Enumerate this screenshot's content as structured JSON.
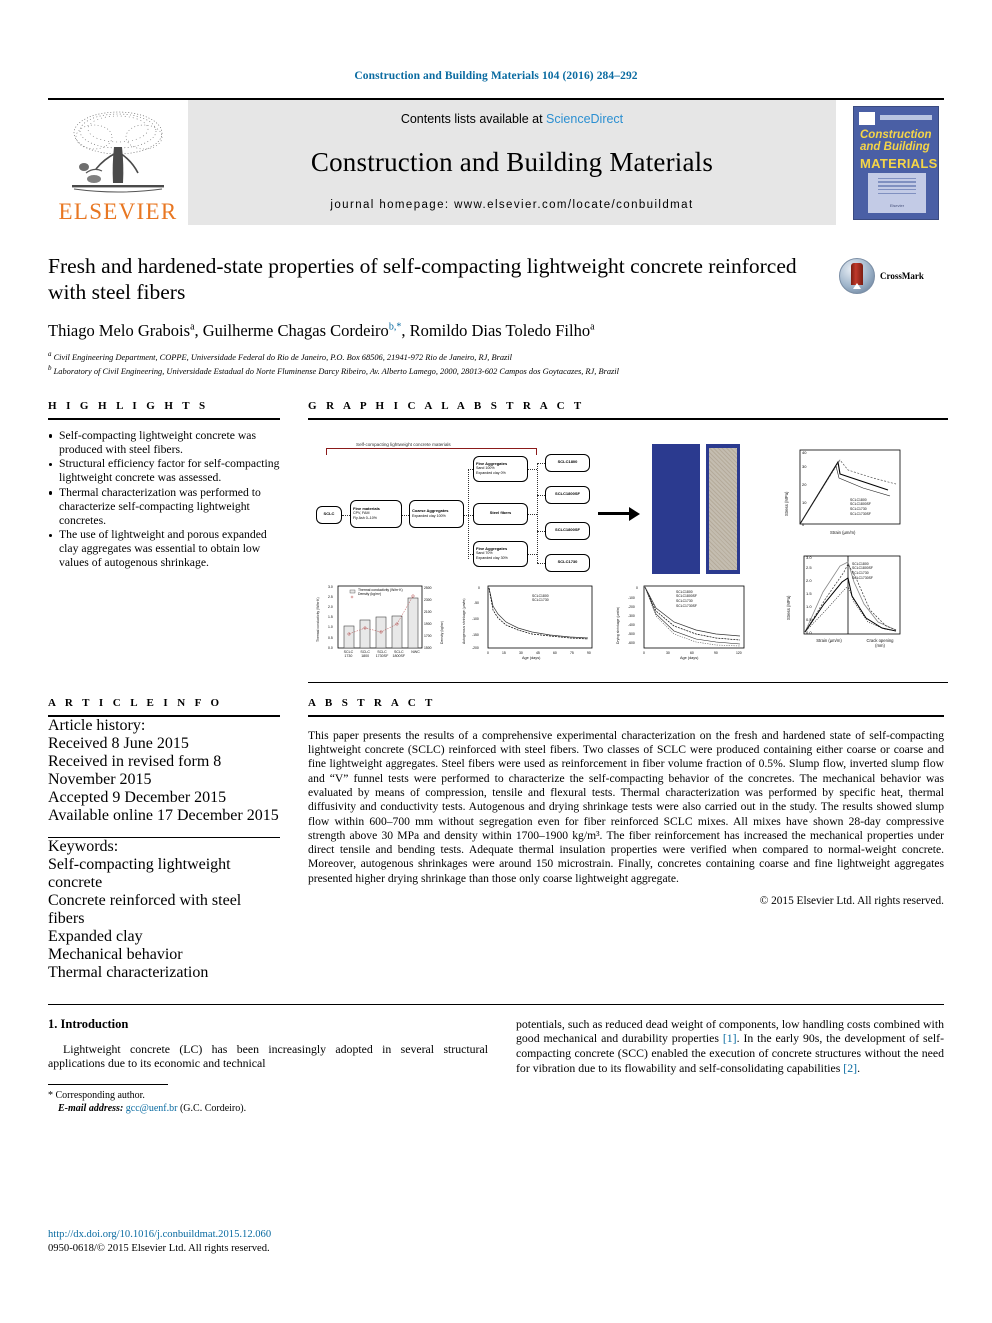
{
  "running_head": "Construction and Building Materials 104 (2016) 284–292",
  "masthead": {
    "contents_prefix": "Contents lists available at ",
    "sciencedirect": "ScienceDirect",
    "journal_name": "Construction and Building Materials",
    "homepage": "journal homepage: www.elsevier.com/locate/conbuildmat",
    "publisher": "ELSEVIER",
    "cover": {
      "line1": "Construction",
      "line2": "and Building",
      "line3": "MATERIALS",
      "blurb": "An international journal dedicated to the investigation and innovative use of materials in construction and repair",
      "foot": "Elsevier"
    }
  },
  "article": {
    "title": "Fresh and hardened-state properties of self-compacting lightweight concrete reinforced with steel fibers",
    "authors": [
      {
        "name": "Thiago Melo Grabois",
        "sup": "a"
      },
      {
        "name": "Guilherme Chagas Cordeiro",
        "sup": "b,*"
      },
      {
        "name": "Romildo Dias Toledo Filho",
        "sup": "a"
      }
    ],
    "affiliations": [
      {
        "mark": "a",
        "text": "Civil Engineering Department, COPPE, Universidade Federal do Rio de Janeiro, P.O. Box 68506, 21941-972 Rio de Janeiro, RJ, Brazil"
      },
      {
        "mark": "b",
        "text": "Laboratory of Civil Engineering, Universidade Estadual do Norte Fluminense Darcy Ribeiro, Av. Alberto Lamego, 2000, 28013-602 Campos dos Goytacazes, RJ, Brazil"
      }
    ],
    "crossmark_label": "CrossMark"
  },
  "highlights": {
    "heading": "H I G H L I G H T S",
    "items": [
      "Self-compacting lightweight concrete was produced with steel fibers.",
      "Structural efficiency factor for self-compacting lightweight concrete was assessed.",
      "Thermal characterization was performed to characterize self-compacting lightweight concretes.",
      "The use of lightweight and porous expanded clay aggregates was essential to obtain low values of autogenous shrinkage."
    ]
  },
  "graphical_abstract": {
    "heading": "G R A P H I C A L   A B S T R A C T",
    "flow_title": "Self-compacting lightweight concrete materials",
    "nodes": {
      "root": "SCLC",
      "fine_materials": {
        "title": "Fine materials",
        "l1": "CPV, FAM",
        "l2": "Fly Ash 0–10%"
      },
      "coarse_agg": {
        "title": "Coarse Aggregates",
        "l1": "Expanded clay 100%"
      },
      "fine_agg_top": {
        "title": "Fine Aggregates",
        "l1": "Sand 100%",
        "l2": "Expanded clay 0%"
      },
      "steel_fibers": {
        "title": "Steel fibers"
      },
      "fine_agg_bot": {
        "title": "Fine Aggregates",
        "l1": "Sand 70%",
        "l2": "Expanded clay 30%"
      }
    },
    "mixes": [
      "SCLC1800",
      "SCLC1800SF",
      "SCLC1800SF",
      "SCLC1730"
    ]
  },
  "chart_data": [
    {
      "type": "bar",
      "id": "thermal-conductivity-density",
      "title": "",
      "xlabel": "",
      "ylabel": "Thermal conductivity (W/m·K)",
      "y2label": "Density (kg/m³)",
      "categories": [
        "SCLC 1730",
        "SCLC 1800",
        "SCLC 1730SF",
        "SCLC 1800SF",
        "NWC"
      ],
      "series": [
        {
          "name": "Thermal conductivity (W/m·K)",
          "values": [
            1.05,
            1.29,
            1.46,
            1.5,
            2.63
          ],
          "kind": "bar"
        },
        {
          "name": "Density (kg/m³)",
          "values": [
            1740,
            1790,
            1730,
            1850,
            2320
          ],
          "kind": "scatter"
        }
      ],
      "ylim": [
        0.0,
        3.0
      ],
      "y2lim": [
        1500,
        2500
      ],
      "yticks": [
        0.0,
        0.5,
        1.0,
        1.5,
        2.0,
        2.5,
        3.0
      ],
      "y2ticks": [
        1500,
        1700,
        1900,
        2100,
        2300,
        2500
      ]
    },
    {
      "type": "line",
      "id": "autogenous-shrinkage",
      "title": "",
      "xlabel": "Age (days)",
      "ylabel": "Autogenous shrinkage (µm/m)",
      "xlim": [
        0,
        90
      ],
      "ylim": [
        -200,
        0
      ],
      "xticks": [
        0,
        15,
        30,
        45,
        60,
        75,
        90
      ],
      "yticks": [
        -200,
        -150,
        -100,
        -50,
        0
      ],
      "series": [
        {
          "name": "SCLC1800",
          "x": [
            0,
            1,
            3,
            7,
            14,
            28,
            56,
            80
          ],
          "y": [
            0,
            -45,
            -70,
            -95,
            -120,
            -145,
            -160,
            -168
          ]
        },
        {
          "name": "SCLC1730",
          "x": [
            0,
            1,
            3,
            7,
            14,
            28,
            56,
            80
          ],
          "y": [
            0,
            -52,
            -78,
            -105,
            -128,
            -150,
            -163,
            -170
          ]
        }
      ]
    },
    {
      "type": "line",
      "id": "drying-shrinkage",
      "title": "",
      "xlabel": "Age (days)",
      "ylabel": "Drying shrinkage (µm/m)",
      "xlim": [
        0,
        120
      ],
      "ylim": [
        -700,
        0
      ],
      "xticks": [
        0,
        30,
        60,
        90,
        120
      ],
      "yticks": [
        -700,
        -600,
        -500,
        -400,
        -300,
        -200,
        -100,
        0
      ],
      "series": [
        {
          "name": "SCLC1800",
          "x": [
            0,
            7,
            28,
            60,
            90,
            120
          ],
          "y": [
            0,
            -240,
            -390,
            -470,
            -510,
            -530
          ]
        },
        {
          "name": "SCLC1800SF",
          "x": [
            0,
            7,
            28,
            60,
            90,
            120
          ],
          "y": [
            0,
            -270,
            -420,
            -500,
            -545,
            -565
          ]
        },
        {
          "name": "SCLC1730",
          "x": [
            0,
            7,
            28,
            60,
            90,
            120
          ],
          "y": [
            0,
            -300,
            -470,
            -560,
            -600,
            -620
          ]
        },
        {
          "name": "SCLC1730SF",
          "x": [
            0,
            7,
            28,
            60,
            90,
            120
          ],
          "y": [
            0,
            -320,
            -500,
            -590,
            -630,
            -650
          ]
        }
      ]
    },
    {
      "type": "line",
      "id": "compressive-stress-strain",
      "title": "",
      "xlabel": "Strain (µm/m)",
      "ylabel": "Stress (MPa)",
      "xlim": [
        0,
        6000
      ],
      "ylim": [
        0,
        40
      ],
      "xticks": [
        0,
        2000,
        4000,
        6000
      ],
      "yticks": [
        0,
        10,
        20,
        30,
        40
      ],
      "legend": [
        "SCLC1800",
        "SCLC1800SF",
        "SCLC1730",
        "SCLC1730SF"
      ],
      "series": [
        {
          "name": "SCLC1800",
          "peak_x": 2300,
          "peak_y": 33
        },
        {
          "name": "SCLC1800SF",
          "peak_x": 2400,
          "peak_y": 33
        },
        {
          "name": "SCLC1730",
          "peak_x": 2200,
          "peak_y": 31
        },
        {
          "name": "SCLC1730SF",
          "peak_x": 2350,
          "peak_y": 32
        }
      ]
    },
    {
      "type": "line",
      "id": "tensile-stress-crack-opening",
      "title": "",
      "xlabel_left": "Strain (µm/m)",
      "xlabel_right": "Crack opening (mm)",
      "ylabel": "Stress (MPa)",
      "ylim": [
        0.0,
        3.0
      ],
      "yticks": [
        0.0,
        0.5,
        1.0,
        1.5,
        2.0,
        2.5,
        3.0
      ],
      "xticks_left": [
        0,
        100,
        200
      ],
      "xticks_right": [
        1,
        2,
        3,
        4,
        5
      ],
      "legend": [
        "SCLC1800",
        "SCLC1800SF",
        "SCLC1730",
        "SCLC1730SF"
      ],
      "series": [
        {
          "name": "SCLC1800",
          "peak_y": 2.85
        },
        {
          "name": "SCLC1800SF",
          "peak_y": 2.9
        },
        {
          "name": "SCLC1730",
          "peak_y": 2.35
        },
        {
          "name": "SCLC1730SF",
          "peak_y": 1.95
        }
      ]
    }
  ],
  "article_info": {
    "heading": "A R T I C L E   I N F O",
    "history_label": "Article history:",
    "history": [
      "Received 8 June 2015",
      "Received in revised form 8 November 2015",
      "Accepted 9 December 2015",
      "Available online 17 December 2015"
    ],
    "keywords_label": "Keywords:",
    "keywords": [
      "Self-compacting lightweight concrete",
      "Concrete reinforced with steel fibers",
      "Expanded clay",
      "Mechanical behavior",
      "Thermal characterization"
    ]
  },
  "abstract": {
    "heading": "A B S T R A C T",
    "text": "This paper presents the results of a comprehensive experimental characterization on the fresh and hardened state of self-compacting lightweight concrete (SCLC) reinforced with steel fibers. Two classes of SCLC were produced containing either coarse or coarse and fine lightweight aggregates. Steel fibers were used as reinforcement in fiber volume fraction of 0.5%. Slump flow, inverted slump flow and “V” funnel tests were performed to characterize the self-compacting behavior of the concretes. The mechanical behavior was evaluated by means of compression, tensile and flexural tests. Thermal characterization was performed by specific heat, thermal diffusivity and conductivity tests. Autogenous and drying shrinkage tests were also carried out in the study. The results showed slump flow within 600–700 mm without segregation even for fiber reinforced SCLC mixes. All mixes have shown 28-day compressive strength above 30 MPa and density within 1700–1900 kg/m³. The fiber reinforcement has increased the mechanical properties under direct tensile and bending tests. Adequate thermal insulation properties were verified when compared to normal-weight concrete. Moreover, autogenous shrinkages were around 150 microstrain. Finally, concretes containing coarse and fine lightweight aggregates presented higher drying shrinkage than those only coarse lightweight aggregate.",
    "copyright": "© 2015 Elsevier Ltd. All rights reserved."
  },
  "introduction": {
    "heading": "1. Introduction",
    "col1_p1": "Lightweight concrete (LC) has been increasingly adopted in several structural applications due to its economic and technical",
    "col2_p1_a": "potentials, such as reduced dead weight of components, low handling costs combined with good mechanical and durability properties ",
    "col2_ref1": "[1]",
    "col2_p1_b": ". In the early 90s, the development of self-compacting concrete (SCC) enabled the execution of concrete structures without the need for vibration due to its flowability and self-consolidating capabilities ",
    "col2_ref2": "[2]",
    "col2_p1_c": "."
  },
  "footnotes": {
    "corresponding": "Corresponding author.",
    "email_label": "E-mail address:",
    "email": "gcc@uenf.br",
    "email_who": "(G.C. Cordeiro).",
    "doi": "http://dx.doi.org/10.1016/j.conbuildmat.2015.12.060",
    "issn_line": "0950-0618/© 2015 Elsevier Ltd. All rights reserved."
  }
}
